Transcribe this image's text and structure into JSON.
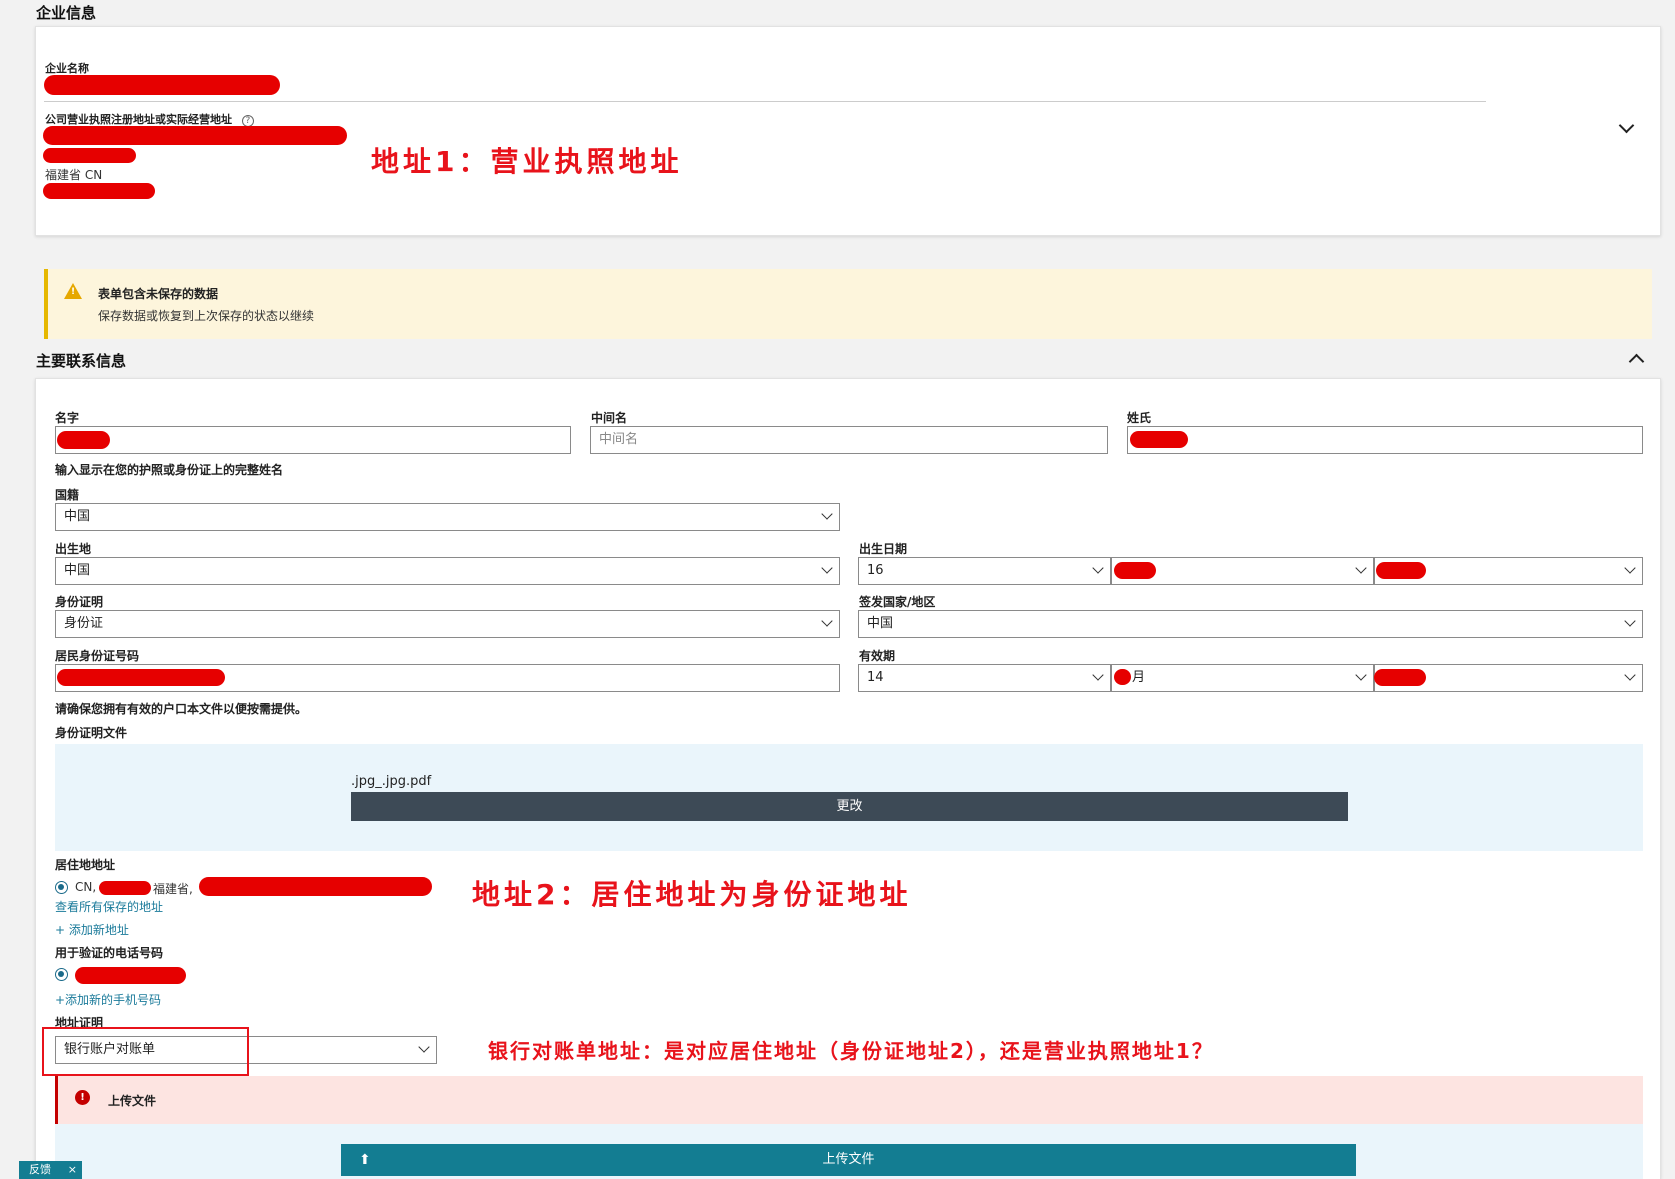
{
  "company": {
    "section_title": "企业信息",
    "name_label": "企业名称",
    "address_label": "公司营业执照注册地址或实际经营地址",
    "address_province": "福建省 CN"
  },
  "annotations": {
    "address1": "地址1：营业执照地址",
    "address2": "地址2：居住地址为身份证地址",
    "bank_question": "银行对账单地址：是对应居住地址（身份证地址2），还是营业执照地址1？"
  },
  "warning": {
    "title": "表单包含未保存的数据",
    "subtitle": "保存数据或恢复到上次保存的状态以继续"
  },
  "contact": {
    "section_title": "主要联系信息",
    "first_name_label": "名字",
    "middle_name_label": "中间名",
    "middle_name_placeholder": "中间名",
    "last_name_label": "姓氏",
    "name_hint": "输入显示在您的护照或身份证上的完整姓名",
    "nationality_label": "国籍",
    "nationality_value": "中国",
    "birthplace_label": "出生地",
    "birthplace_value": "中国",
    "dob_label": "出生日期",
    "dob_day": "16",
    "id_type_label": "身份证明",
    "id_type_value": "身份证",
    "issuing_country_label": "签发国家/地区",
    "issuing_country_value": "中国",
    "id_number_label": "居民身份证号码",
    "expiry_label": "有效期",
    "expiry_day": "14",
    "expiry_month_suffix": "月",
    "hukou_hint": "请确保您拥有有效的户口本文件以便按需提供。",
    "id_doc_label": "身份证明文件",
    "file_name": ".jpg_.jpg.pdf",
    "change_button": "更改",
    "residence_label": "居住地地址",
    "residence_country": "CN,",
    "residence_province": "福建省,",
    "view_saved_addresses": "查看所有保存的地址",
    "add_address": "+ 添加新地址",
    "phone_label": "用于验证的电话号码",
    "add_phone": "+添加新的手机号码",
    "proof_label": "地址证明",
    "proof_value": "银行账户对账单",
    "upload_error_label": "上传文件",
    "upload_button": "上传文件"
  },
  "feedback": {
    "label": "反馈",
    "close": "×"
  },
  "colors": {
    "annotation_red": "#e8131b",
    "redaction_red": "#e60000",
    "warning_bg": "#fdf5dc",
    "warning_border": "#e6b800",
    "upload_zone_bg": "#eaf5fb",
    "error_bg": "#fde4e1",
    "teal_button": "#137d92",
    "dark_button": "#3d4a56"
  }
}
